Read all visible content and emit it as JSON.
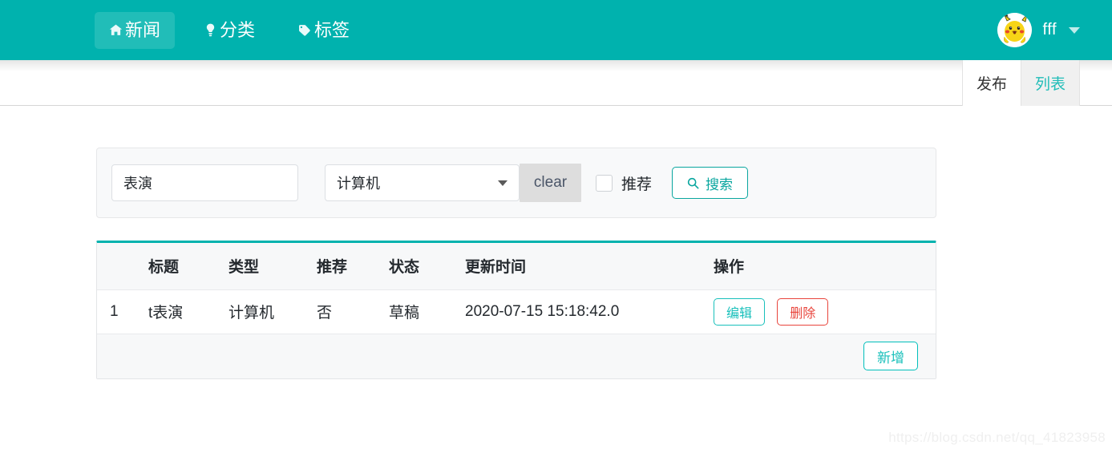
{
  "navbar": {
    "brand_color": "#00b2ae",
    "active_item_color": "#21bdb8",
    "items": [
      {
        "label": "新闻",
        "icon": "home-icon",
        "active": true
      },
      {
        "label": "分类",
        "icon": "lightbulb-icon",
        "active": false
      },
      {
        "label": "标签",
        "icon": "tag-icon",
        "active": false
      }
    ],
    "user": {
      "name": "fff",
      "avatar_icon": "pikachu-avatar",
      "caret_icon": "chevron-down-icon"
    }
  },
  "tabs": [
    {
      "label": "发布",
      "active": false
    },
    {
      "label": "列表",
      "active": true
    }
  ],
  "search": {
    "title_value": "表演",
    "title_placeholder": "",
    "type_selected": "计算机",
    "select_caret_icon": "caret-down-icon",
    "clear_label": "clear",
    "recommend_label": "推荐",
    "recommend_checked": false,
    "search_label": "搜索",
    "search_icon": "search-icon",
    "accent_color": "#0aa69f"
  },
  "table": {
    "top_border_color": "#00b2ae",
    "headers": [
      "",
      "标题",
      "类型",
      "推荐",
      "状态",
      "更新时间",
      "操作"
    ],
    "rows": [
      {
        "index": "1",
        "title": "t表演",
        "type": "计算机",
        "recommend": "否",
        "status": "草稿",
        "updated_at": "2020-07-15 15:18:42.0",
        "edit_label": "编辑",
        "delete_label": "删除"
      }
    ],
    "footer": {
      "add_label": "新增"
    }
  },
  "watermark": {
    "text": "https://blog.csdn.net/qq_41823958"
  }
}
